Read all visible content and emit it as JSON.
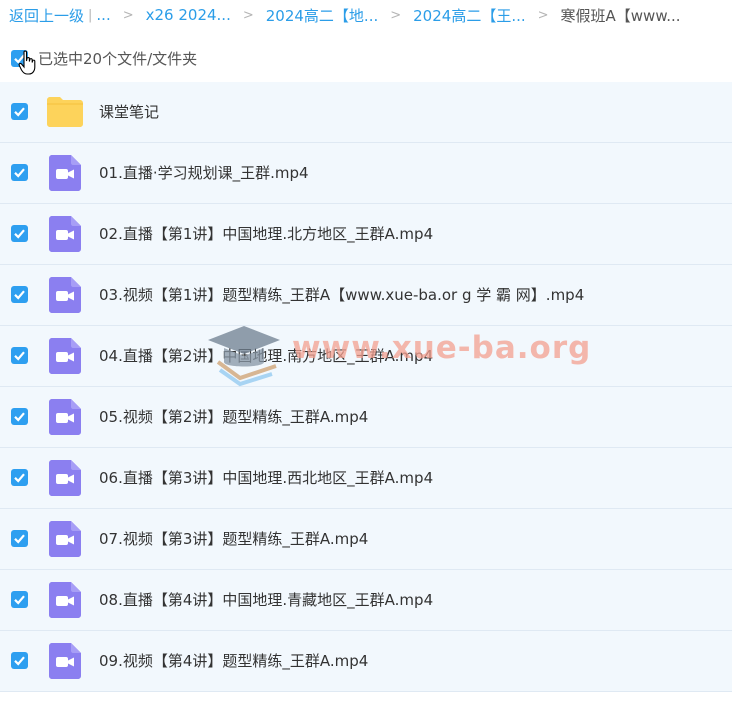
{
  "breadcrumb": {
    "back": "返回上一级",
    "divider": "|",
    "ellipsis": "...",
    "chevron": ">",
    "items": [
      "x26 2024...",
      "2024高二【地...",
      "2024高二【王...",
      "寒假班A【www..."
    ]
  },
  "selection": {
    "label": "已选中20个文件/文件夹",
    "checked": true
  },
  "files": [
    {
      "name": "课堂笔记",
      "type": "folder",
      "icon": "folder-icon"
    },
    {
      "name": "01.直播·学习规划课_王群.mp4",
      "type": "video",
      "icon": "video-icon"
    },
    {
      "name": "02.直播【第1讲】中国地理.北方地区_王群A.mp4",
      "type": "video",
      "icon": "video-icon"
    },
    {
      "name": "03.视频【第1讲】题型精练_王群A【www.xue-ba.or g 学 霸 网】.mp4",
      "type": "video",
      "icon": "video-icon"
    },
    {
      "name": "04.直播【第2讲】中国地理.南方地区_王群A.mp4",
      "type": "video",
      "icon": "video-icon"
    },
    {
      "name": "05.视频【第2讲】题型精练_王群A.mp4",
      "type": "video",
      "icon": "video-icon"
    },
    {
      "name": "06.直播【第3讲】中国地理.西北地区_王群A.mp4",
      "type": "video",
      "icon": "video-icon"
    },
    {
      "name": "07.视频【第3讲】题型精练_王群A.mp4",
      "type": "video",
      "icon": "video-icon"
    },
    {
      "name": "08.直播【第4讲】中国地理.青藏地区_王群A.mp4",
      "type": "video",
      "icon": "video-icon"
    },
    {
      "name": "09.视频【第4讲】题型精练_王群A.mp4",
      "type": "video",
      "icon": "video-icon"
    }
  ],
  "watermark": {
    "text": "www.xue-ba.org"
  },
  "colors": {
    "link": "#2b9de8",
    "checkbox": "#2e9ff0",
    "row_bg": "#f2f8fd",
    "folder": "#fdd35b",
    "video": "#8b7ff0"
  }
}
